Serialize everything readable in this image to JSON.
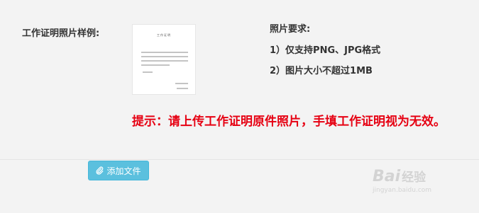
{
  "form": {
    "label": "工作证明照片样例:"
  },
  "sample": {
    "title": "工作证明"
  },
  "requirements": {
    "title": "照片要求:",
    "items": [
      "1）仅支持PNG、JPG格式",
      "2）图片大小不超过1MB"
    ]
  },
  "warning": {
    "text": "提示：请上传工作证明原件照片，手填工作证明视为无效。",
    "color": "#e60012"
  },
  "upload": {
    "label": "添加文件",
    "icon": "paperclip-icon",
    "color": "#5bc0de"
  },
  "watermark": {
    "brand": "Bai",
    "brand_suffix": "经验",
    "url": "jingyan.baidu.com"
  }
}
